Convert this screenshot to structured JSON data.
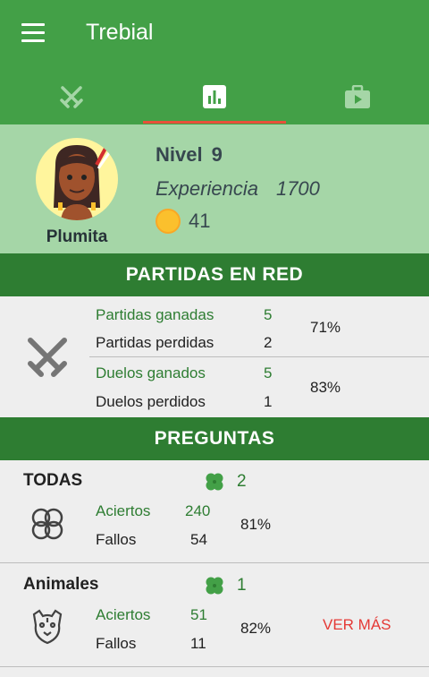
{
  "appbar": {
    "title": "Trebial"
  },
  "profile": {
    "name": "Plumita",
    "level_label": "Nivel",
    "level_value": "9",
    "exp_label": "Experiencia",
    "exp_value": "1700",
    "coins": "41"
  },
  "network": {
    "header": "PARTIDAS EN RED",
    "games_won_label": "Partidas ganadas",
    "games_won": "5",
    "games_lost_label": "Partidas perdidas",
    "games_lost": "2",
    "games_pct": "71%",
    "duels_won_label": "Duelos ganados",
    "duels_won": "5",
    "duels_lost_label": "Duelos perdidos",
    "duels_lost": "1",
    "duels_pct": "83%"
  },
  "questions": {
    "header": "PREGUNTAS",
    "categories": [
      {
        "name": "TODAS",
        "clovers": "2",
        "hits_label": "Aciertos",
        "hits": "240",
        "fails_label": "Fallos",
        "fails": "54",
        "pct": "81%"
      },
      {
        "name": "Animales",
        "clovers": "1",
        "hits_label": "Aciertos",
        "hits": "51",
        "fails_label": "Fallos",
        "fails": "11",
        "pct": "82%",
        "more": "VER MÁS"
      }
    ]
  },
  "colors": {
    "primary": "#43a047",
    "dark": "#2e7d32",
    "light": "#a5d6a7",
    "accent": "#e53935"
  },
  "icons": {
    "menu": "menu-icon",
    "tab1": "swords-icon",
    "tab2": "bar-chart-icon",
    "tab3": "briefcase-icon"
  }
}
